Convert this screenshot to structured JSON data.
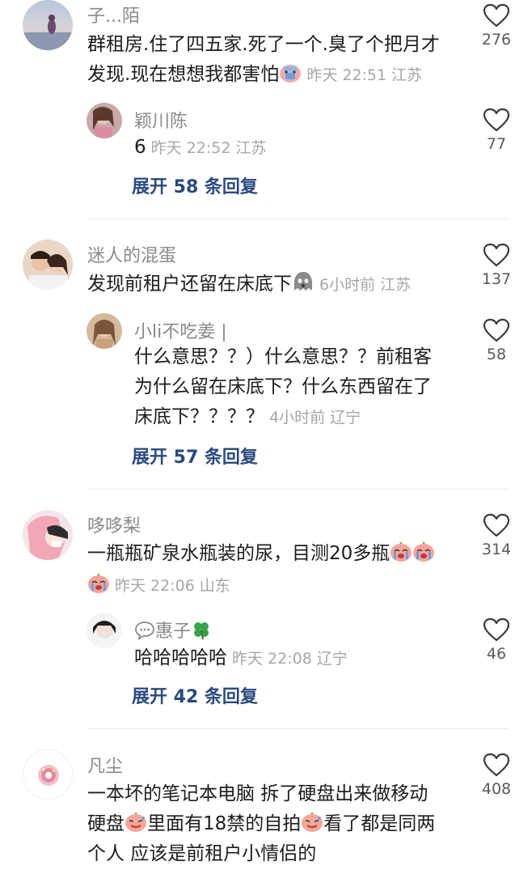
{
  "comments": [
    {
      "user": "子...陌",
      "text_lines": [
        "群租房.住了四五家.死了一个.臭了个把月才",
        "发现.现在想想我都害怕"
      ],
      "emoji": "scared-face-emoji",
      "time": "昨天 22:51",
      "location": "江苏",
      "likes": "276",
      "reply": {
        "user": "颖川陈",
        "text": "6",
        "time": "昨天 22:52",
        "location": "江苏",
        "likes": "77"
      },
      "expand_label": "展开 58 条回复"
    },
    {
      "user": "迷人的混蛋",
      "text_lines": [
        "发现前租户还留在床底下"
      ],
      "emoji": "ghost-face-emoji",
      "time": "6小时前",
      "location": "江苏",
      "likes": "137",
      "reply": {
        "user": "小li不吃姜 |",
        "text_lines": [
          "什么意思？？）什么意思？？前租客",
          "为什么留在床底下？什么东西留在了",
          "床底下？？？？"
        ],
        "time": "4小时前",
        "location": "辽宁",
        "likes": "58"
      },
      "expand_label": "展开 57 条回复"
    },
    {
      "user": "哆哆梨",
      "text_lines": [
        "一瓶瓶矿泉水瓶装的尿，目测20多瓶"
      ],
      "emoji": "crying-face-emoji",
      "time": "昨天 22:06",
      "location": "山东",
      "likes": "314",
      "reply": {
        "user": "惠子",
        "text": "哈哈哈哈哈",
        "time": "昨天 22:08",
        "location": "辽宁",
        "likes": "46"
      },
      "expand_label": "展开 42 条回复"
    },
    {
      "user": "凡尘",
      "text_lines": [
        "一本坏的笔记本电脑   拆了硬盘出来做移动",
        "硬盘",
        "里面有18禁的自拍",
        "看了都是同两",
        "个人  应该是前租户小情侣的"
      ],
      "emoji": "sweat-face-emoji",
      "likes": "408"
    }
  ],
  "colors": {
    "name": "#8a8a8a",
    "meta": "#a6a6a6",
    "expand": "#2a4a7e",
    "text": "#1c1c1c"
  }
}
